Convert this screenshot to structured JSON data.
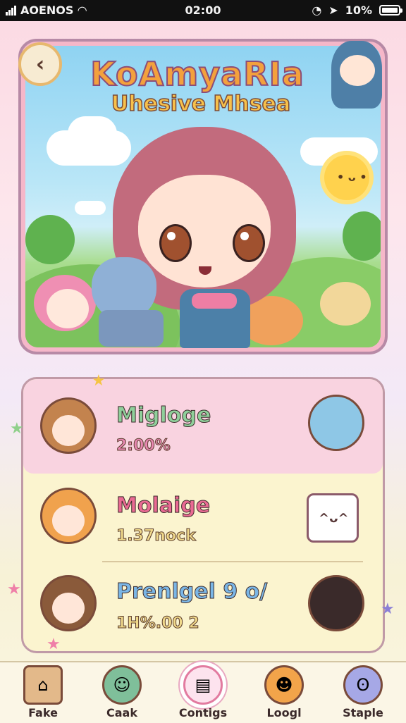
{
  "status_bar": {
    "carrier": "AOENOS",
    "time": "02:00",
    "battery": "10%",
    "icons": [
      "signal-icon",
      "wifi-icon",
      "alarm-icon",
      "location-icon",
      "battery-icon"
    ]
  },
  "header": {
    "back_icon": "back-arrow-icon",
    "title": "KoAmyaRIa",
    "subtitle": "Uhesive Mhsea"
  },
  "list": {
    "items": [
      {
        "title": "Migloge",
        "value": "2:00%",
        "title_color": "#8fcf9a",
        "avatar": "girl-avatar",
        "image": "bluehair-girl-avatar"
      },
      {
        "title": "Molaige",
        "value": "1.37nock",
        "title_color": "#ea6a93",
        "avatar": "orangehair-girl-avatar",
        "image": "cat-cup-icon"
      },
      {
        "title": "Prenlgel 9 o/",
        "value": "1H%.00 2",
        "title_color": "#7ab6e6",
        "avatar": "brownhair-girl-avatar",
        "image": "pinkhat-girl-avatar"
      }
    ]
  },
  "nav": {
    "items": [
      {
        "label": "Fake",
        "icon": "house-icon"
      },
      {
        "label": "Caak",
        "icon": "character-icon"
      },
      {
        "label": "Contigs",
        "icon": "book-icon",
        "active": true
      },
      {
        "label": "Loogl",
        "icon": "fox-icon"
      },
      {
        "label": "Staple",
        "icon": "blob-icon"
      }
    ]
  }
}
